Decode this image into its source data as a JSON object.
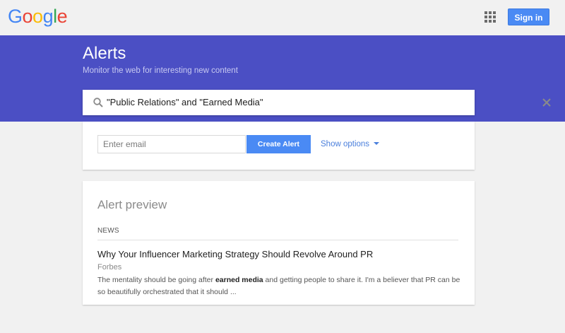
{
  "header": {
    "logo_letters": [
      {
        "ch": "G",
        "color": "#4285F4"
      },
      {
        "ch": "o",
        "color": "#EA4335"
      },
      {
        "ch": "o",
        "color": "#FBBC05"
      },
      {
        "ch": "g",
        "color": "#4285F4"
      },
      {
        "ch": "l",
        "color": "#34A853"
      },
      {
        "ch": "e",
        "color": "#EA4335"
      }
    ],
    "apps_icon": "apps-grid-icon",
    "signin_label": "Sign in"
  },
  "hero": {
    "title": "Alerts",
    "subtitle": "Monitor the web for interesting new content",
    "background": "#4b4fc4"
  },
  "search": {
    "query": "\"Public Relations\" and \"Earned Media\"",
    "search_icon": "search-icon",
    "clear_icon": "close-icon"
  },
  "create": {
    "email_placeholder": "Enter email",
    "create_label": "Create Alert",
    "show_options_label": "Show options",
    "accent": "#4a8af4"
  },
  "preview": {
    "title": "Alert preview",
    "section": "NEWS",
    "article": {
      "title": "Why Your Influencer Marketing Strategy Should Revolve Around PR",
      "source": "Forbes",
      "snippet_before": "The mentality should be going after ",
      "snippet_bold": "earned media",
      "snippet_after": " and getting people to share it. I'm a believer that PR can be so beautifully orchestrated that it should ..."
    }
  }
}
